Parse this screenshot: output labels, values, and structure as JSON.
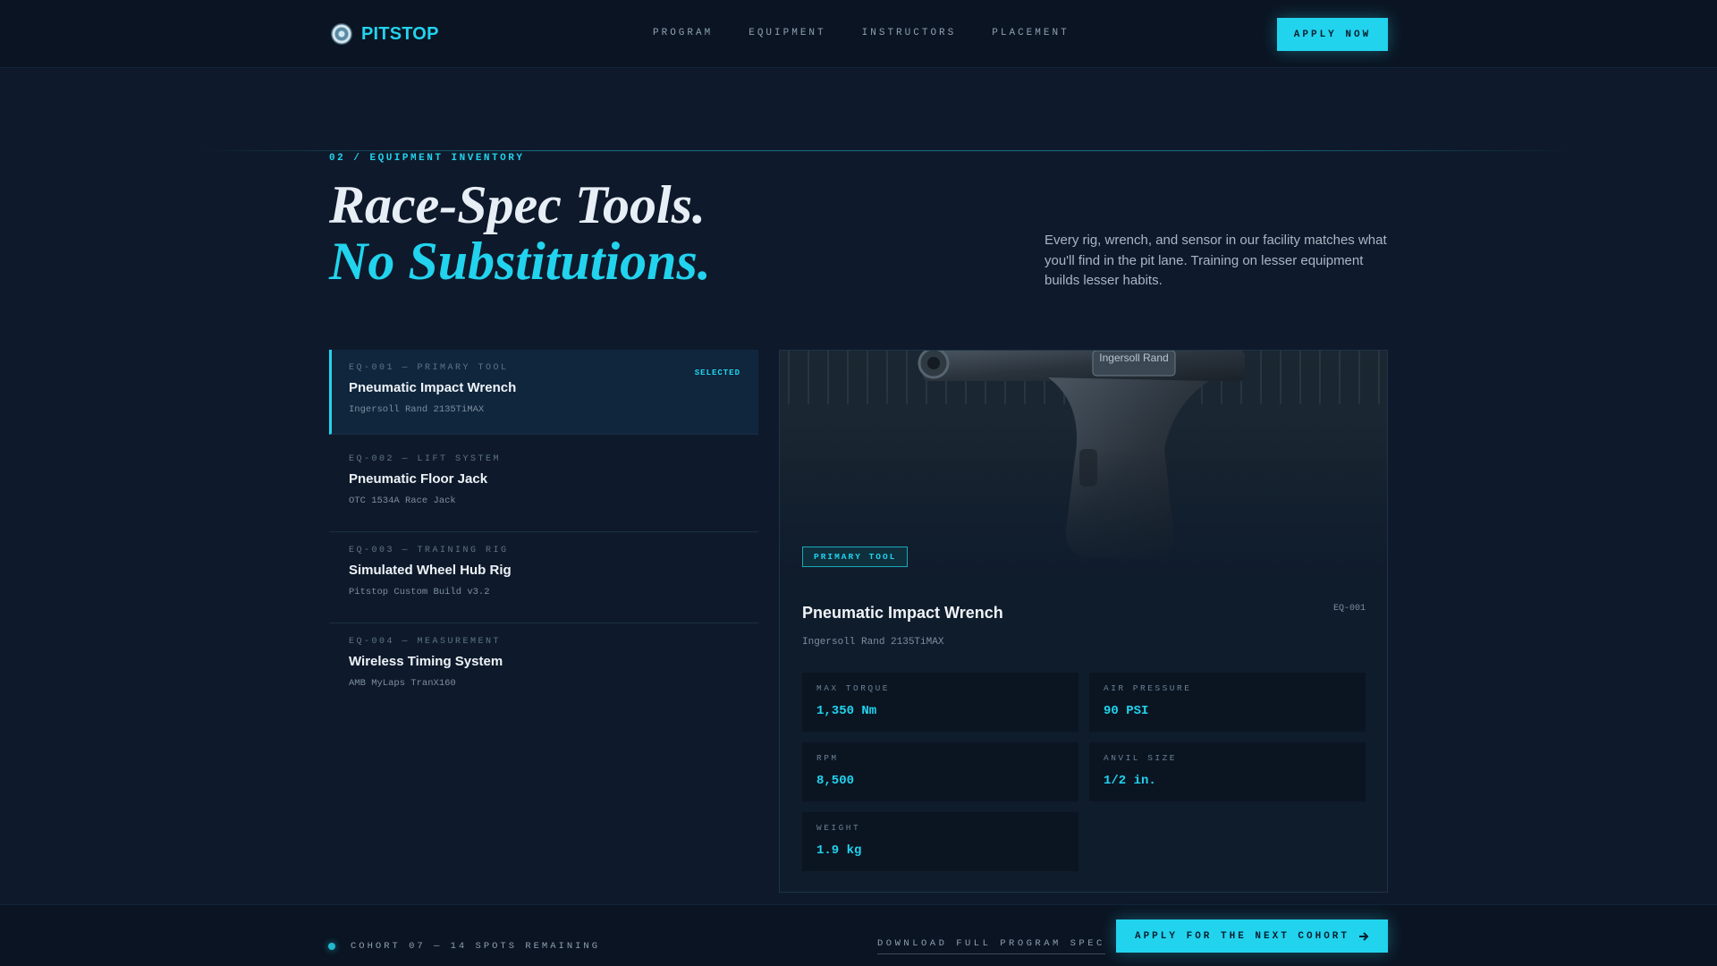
{
  "brand": {
    "name": "PITSTOP"
  },
  "nav": {
    "items": [
      "PROGRAM",
      "EQUIPMENT",
      "INSTRUCTORS",
      "PLACEMENT"
    ]
  },
  "header": {
    "apply_label": "APPLY NOW"
  },
  "section": {
    "eyebrow": "02 / EQUIPMENT INVENTORY",
    "headline_line1": "Race-Spec Tools.",
    "headline_line2": "No Substitutions.",
    "intro": "Every rig, wrench, and sensor in our facility matches what you'll find in the pit lane. Training on lesser equipment builds lesser habits."
  },
  "equipment": [
    {
      "code": "EQ-001 — PRIMARY TOOL",
      "name": "Pneumatic Impact Wrench",
      "model": "Ingersoll Rand 2135TiMAX",
      "tag": "SELECTED"
    },
    {
      "code": "EQ-002 — LIFT SYSTEM",
      "name": "Pneumatic Floor Jack",
      "model": "OTC 1534A Race Jack",
      "tag": ""
    },
    {
      "code": "EQ-003 — TRAINING RIG",
      "name": "Simulated Wheel Hub Rig",
      "model": "Pitstop Custom Build v3.2",
      "tag": ""
    },
    {
      "code": "EQ-004 — MEASUREMENT",
      "name": "Wireless Timing System",
      "model": "AMB MyLaps TranX160",
      "tag": ""
    }
  ],
  "detail": {
    "badge": "PRIMARY TOOL",
    "title": "Pneumatic Impact Wrench",
    "id": "EQ-001",
    "model": "Ingersoll Rand 2135TiMAX",
    "photo_brand": "Ingersoll Rand",
    "specs": [
      {
        "label": "MAX TORQUE",
        "value": "1,350 Nm"
      },
      {
        "label": "AIR PRESSURE",
        "value": "90 PSI"
      },
      {
        "label": "RPM",
        "value": "8,500"
      },
      {
        "label": "ANVIL SIZE",
        "value": "1/2 in."
      },
      {
        "label": "WEIGHT",
        "value": "1.9 kg"
      }
    ]
  },
  "footer": {
    "cohort": "COHORT 07 — 14 SPOTS REMAINING",
    "download_label": "DOWNLOAD FULL PROGRAM SPEC",
    "next_label": "APPLY FOR THE NEXT COHORT"
  },
  "colors": {
    "accent": "#22d3ee",
    "background": "#0e1a2b",
    "header": "#0b1422"
  }
}
